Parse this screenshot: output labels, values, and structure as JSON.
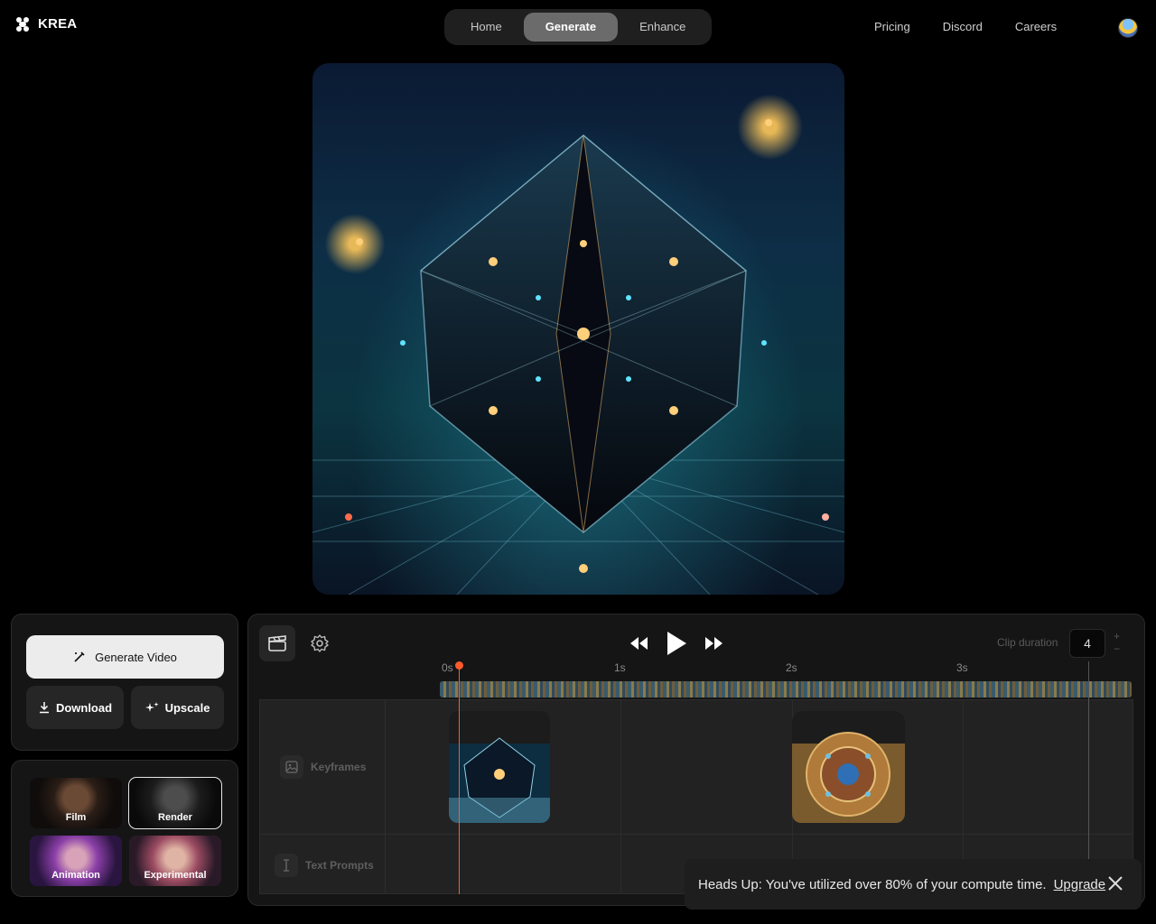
{
  "header": {
    "brand": "KREA",
    "nav": [
      {
        "label": "Home",
        "active": false
      },
      {
        "label": "Generate",
        "active": true
      },
      {
        "label": "Enhance",
        "active": false
      }
    ],
    "links": [
      "Pricing",
      "Discord",
      "Careers"
    ],
    "avatar_icon": "user-avatar"
  },
  "preview": {
    "icon": "generated-image"
  },
  "actions": {
    "generate_video": "Generate Video",
    "download": "Download",
    "upscale": "Upscale"
  },
  "styles": [
    {
      "label": "Film",
      "selected": false
    },
    {
      "label": "Render",
      "selected": true
    },
    {
      "label": "Animation",
      "selected": false
    },
    {
      "label": "Experimental",
      "selected": false
    }
  ],
  "timeline": {
    "clip_duration_label": "Clip duration",
    "clip_duration_value": "4",
    "stepper_plus": "+",
    "stepper_minus": "−",
    "ticks": [
      "0s",
      "1s",
      "2s",
      "3s"
    ],
    "tracks": {
      "keyframes": "Keyframes",
      "text_prompts": "Text Prompts"
    },
    "transport_icons": [
      "rewind-icon",
      "play-icon",
      "fast-forward-icon"
    ]
  },
  "toast": {
    "message": "Heads Up: You've utilized over 80% of your compute time.",
    "link": "Upgrade"
  },
  "colors": {
    "accent": "#ff5a2d",
    "panel": "#151515"
  }
}
